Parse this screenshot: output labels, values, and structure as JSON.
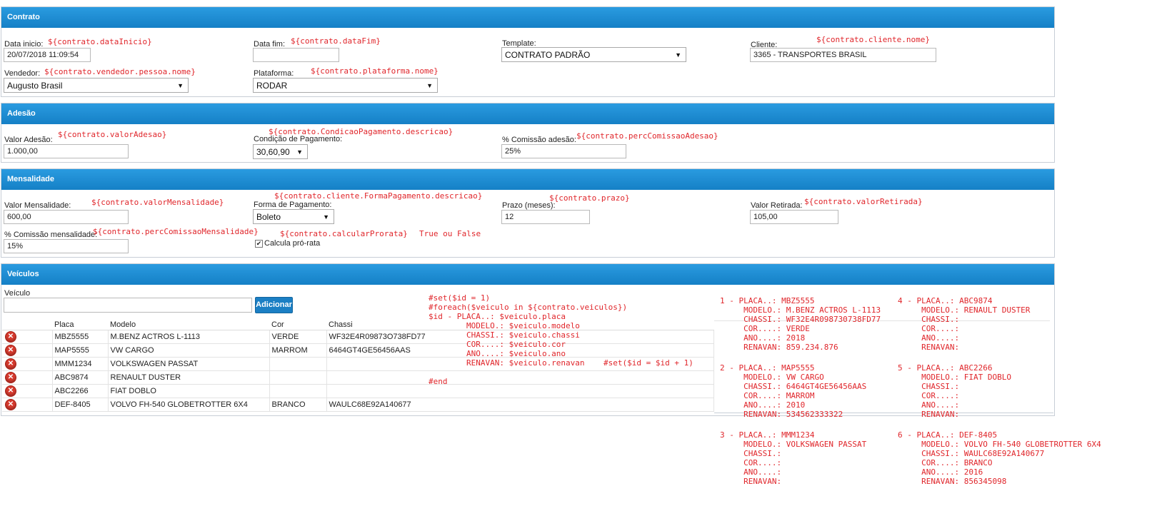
{
  "contrato": {
    "header": "Contrato",
    "data_inicio": {
      "label": "Data inicio:",
      "value": "20/07/2018 11:09:54",
      "tpl": "${contrato.dataInicio}"
    },
    "data_fim": {
      "label": "Data fim:",
      "value": "",
      "tpl": "${contrato.dataFim}"
    },
    "template": {
      "label": "Template:",
      "value": "CONTRATO PADRÃO"
    },
    "cliente": {
      "label": "Cliente:",
      "value": "3365 - TRANSPORTES BRASIL",
      "tpl": "${contrato.cliente.nome}"
    },
    "vendedor": {
      "label": "Vendedor:",
      "value": "Augusto Brasil",
      "tpl": "${contrato.vendedor.pessoa.nome}"
    },
    "plataforma": {
      "label": "Plataforma:",
      "value": "RODAR",
      "tpl": "${contrato.plataforma.nome}"
    }
  },
  "adesao": {
    "header": "Adesão",
    "valor": {
      "label": "Valor Adesão:",
      "value": "1.000,00",
      "tpl": "${contrato.valorAdesao}"
    },
    "condicao": {
      "label": "Condição de Pagamento:",
      "value": "30,60,90",
      "tpl": "${contrato.CondicaoPagamento.descricao}"
    },
    "comissao": {
      "label": "% Comissão adesão:",
      "value": "25%",
      "tpl": "${contrato.percComissaoAdesao}"
    }
  },
  "mensalidade": {
    "header": "Mensalidade",
    "valor": {
      "label": "Valor Mensalidade:",
      "value": "600,00",
      "tpl": "${contrato.valorMensalidade}"
    },
    "forma": {
      "label": "Forma de Pagamento:",
      "value": "Boleto",
      "tpl": "${contrato.cliente.FormaPagamento.descricao}"
    },
    "prazo": {
      "label": "Prazo (meses):",
      "value": "12",
      "tpl": "${contrato.prazo}"
    },
    "retirada": {
      "label": "Valor Retirada:",
      "value": "105,00",
      "tpl": "${contrato.valorRetirada}"
    },
    "comissao": {
      "label": "% Comissão mensalidade:",
      "value": "15%",
      "tpl": "${contrato.percComissaoMensalidade}"
    },
    "prorata": {
      "label": "Calcula pró-rata",
      "checked": true,
      "tpl": "${contrato.calcularProrata}",
      "tpl_note": "True ou False"
    }
  },
  "veiculos": {
    "header": "Veículos",
    "input_label": "Veículo",
    "add_button": "Adicionar",
    "columns": [
      "Placa",
      "Modelo",
      "Cor",
      "Chassi"
    ],
    "rows": [
      {
        "placa": "MBZ5555",
        "modelo": "M.BENZ ACTROS L-1113",
        "cor": "VERDE",
        "chassi": "WF32E4R09873O738FD77"
      },
      {
        "placa": "MAP5555",
        "modelo": "VW CARGO",
        "cor": "MARROM",
        "chassi": "6464GT4GE56456AAS"
      },
      {
        "placa": "MMM1234",
        "modelo": "VOLKSWAGEN PASSAT",
        "cor": "",
        "chassi": ""
      },
      {
        "placa": "ABC9874",
        "modelo": "RENAULT DUSTER",
        "cor": "",
        "chassi": ""
      },
      {
        "placa": "ABC2266",
        "modelo": "FIAT DOBLO",
        "cor": "",
        "chassi": ""
      },
      {
        "placa": "DEF-8405",
        "modelo": "VOLVO FH-540 GLOBETROTTER 6X4",
        "cor": "BRANCO",
        "chassi": "WAULC68E92A140677"
      }
    ]
  },
  "template_code": "#set($id = 1)\n#foreach($veiculo in ${contrato.veiculos})\n$id - PLACA..: $veiculo.placa\n        MODELO.: $veiculo.modelo\n        CHASSI.: $veiculo.chassi\n        COR....: $veiculo.cor\n        ANO....: $veiculo.ano\n        RENAVAN: $veiculo.renavan    #set($id = $id + 1)\n\n#end",
  "output_blocks": [
    "1 - PLACA..: MBZ5555\n     MODELO.: M.BENZ ACTROS L-1113\n     CHASSI.: WF32E4R098730738FD77\n     COR....: VERDE\n     ANO....: 2018\n     RENAVAN: 859.234.876",
    "2 - PLACA..: MAP5555\n     MODELO.: VW CARGO\n     CHASSI.: 6464GT4GE56456AAS\n     COR....: MARROM\n     ANO....: 2010\n     RENAVAN: 534562333322",
    "3 - PLACA..: MMM1234\n     MODELO.: VOLKSWAGEN PASSAT\n     CHASSI.:\n     COR....:\n     ANO....:\n     RENAVAN:",
    "4 - PLACA..: ABC9874\n     MODELO.: RENAULT DUSTER\n     CHASSI.:\n     COR....:\n     ANO....:\n     RENAVAN:",
    "5 - PLACA..: ABC2266\n     MODELO.: FIAT DOBLO\n     CHASSI.:\n     COR....:\n     ANO....:\n     RENAVAN:",
    "6 - PLACA..: DEF-8405\n     MODELO.: VOLVO FH-540 GLOBETROTTER 6X4\n     CHASSI.: WAULC68E92A140677\n     COR....: BRANCO\n     ANO....: 2016\n     RENAVAN: 856345098"
  ],
  "icons": {
    "delete": "delete-circle-icon",
    "dropdown": "chevron-down-icon"
  },
  "colors": {
    "header_blue": "#1e8fd6",
    "annotation_red": "#e0262b"
  }
}
